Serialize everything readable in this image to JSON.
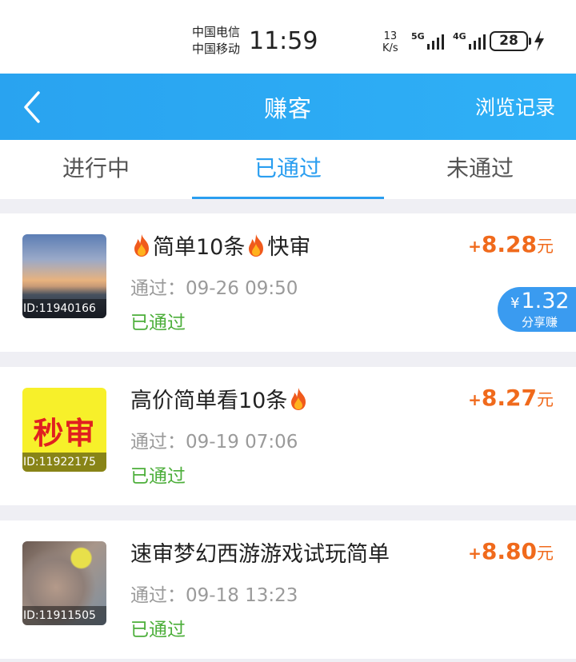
{
  "status_bar": {
    "carrier1": "中国电信",
    "carrier2": "中国移动",
    "time": "11:59",
    "speed_value": "13",
    "speed_unit": "K/s",
    "network1": "5G",
    "network2": "4G",
    "battery": "28"
  },
  "header": {
    "title": "赚客",
    "history_label": "浏览记录",
    "back_icon": "chevron-left-icon"
  },
  "tabs": [
    {
      "label": "进行中",
      "active": false
    },
    {
      "label": "已通过",
      "active": true
    },
    {
      "label": "未通过",
      "active": false
    }
  ],
  "tasks": [
    {
      "id_label": "ID:11940166",
      "title_parts": [
        "简单10条",
        "快审"
      ],
      "pass_time": "通过：09-26 09:50",
      "status": "已通过",
      "amount_plus": "+",
      "amount": "8.28",
      "unit": "元",
      "share": {
        "currency": "¥",
        "value": "1.32",
        "label": "分享赚"
      }
    },
    {
      "id_label": "ID:11922175",
      "thumb_text": "秒审",
      "title_parts": [
        "高价简单看10条"
      ],
      "pass_time": "通过：09-19 07:06",
      "status": "已通过",
      "amount_plus": "+",
      "amount": "8.27",
      "unit": "元"
    },
    {
      "id_label": "ID:11911505",
      "title_parts": [
        "速审梦幻西游游戏试玩简单"
      ],
      "pass_time": "通过：09-18 13:23",
      "status": "已通过",
      "amount_plus": "+",
      "amount": "8.80",
      "unit": "元"
    }
  ],
  "colors": {
    "header_blue": "#2aa6f2",
    "tab_active": "#2a9ef0",
    "amount_orange": "#f06a1c",
    "status_green": "#4cae3a",
    "share_blue": "#3a9bf0"
  }
}
